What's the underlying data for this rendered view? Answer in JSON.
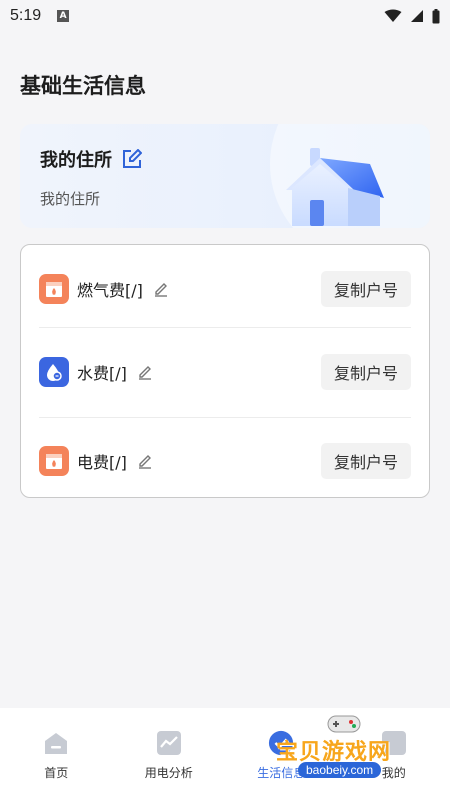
{
  "status_bar": {
    "time": "5:19"
  },
  "page": {
    "title": "基础生活信息"
  },
  "residence": {
    "heading": "我的住所",
    "subtitle": "我的住所"
  },
  "bills": [
    {
      "label": "燃气费[/]",
      "icon": "gas-icon",
      "color": "#f4835a",
      "button": "复制户号"
    },
    {
      "label": "水费[/]",
      "icon": "water-icon",
      "color": "#3b66e0",
      "button": "复制户号"
    },
    {
      "label": "电费[/]",
      "icon": "electricity-icon",
      "color": "#f4835a",
      "button": "复制户号"
    }
  ],
  "nav": {
    "items": [
      {
        "label": "首页",
        "icon": "home-icon"
      },
      {
        "label": "用电分析",
        "icon": "chart-icon"
      },
      {
        "label": "生活信息",
        "icon": "check-circle-icon",
        "active": true
      },
      {
        "label": "我的",
        "icon": "profile-icon"
      }
    ],
    "active_color": "#3a6de0"
  },
  "watermark": {
    "title": "宝贝游戏网",
    "url": "baobeiy.com"
  }
}
